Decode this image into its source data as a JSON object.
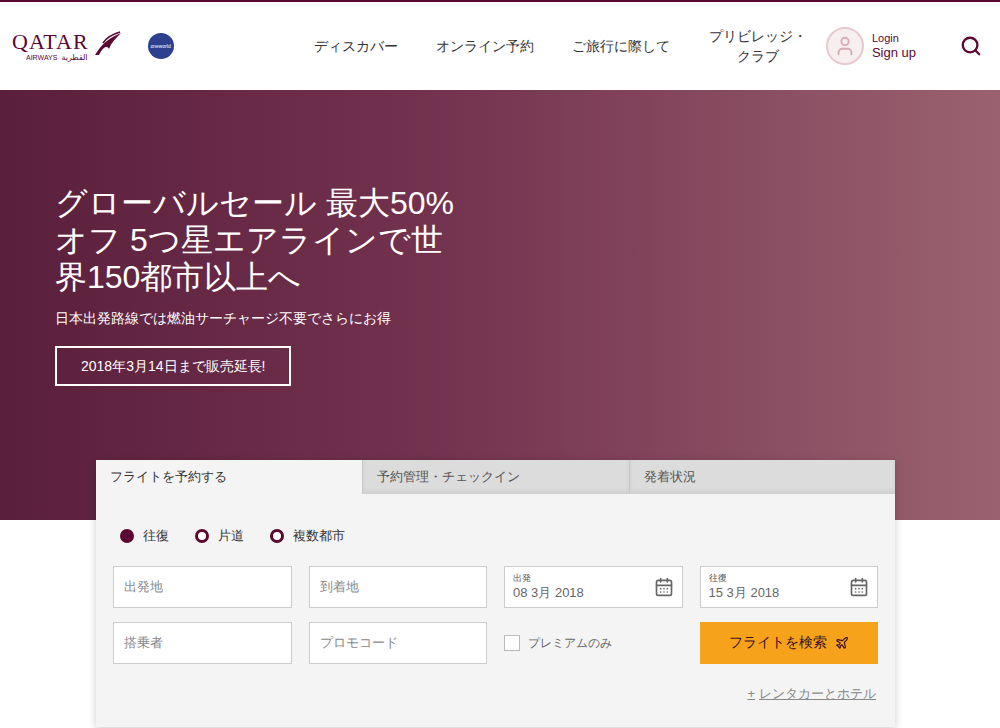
{
  "header": {
    "logo": {
      "name": "QATAR",
      "sub": "AIRWAYS",
      "arabic": "القطرية"
    },
    "alliance_badge": "oneworld",
    "nav": [
      "ディスカバー",
      "オンライン予約",
      "ご旅行に際して",
      "プリビレッジ・クラブ"
    ],
    "login": "Login",
    "signup": "Sign up"
  },
  "hero": {
    "headline_lines": [
      "グローバルセール 最大50%",
      "オフ 5つ星エアラインで世",
      "界150都市以上へ"
    ],
    "subline": "日本出発路線では燃油サーチャージ不要でさらにお得",
    "button": "2018年3月14日まで販売延長!"
  },
  "booking": {
    "tabs": [
      {
        "label": "フライトを予約する",
        "selected": true
      },
      {
        "label": "予約管理・チェックイン",
        "selected": false
      },
      {
        "label": "発着状況",
        "selected": false
      }
    ],
    "trip_types": [
      {
        "label": "往復",
        "selected": true
      },
      {
        "label": "片道",
        "selected": false
      },
      {
        "label": "複数都市",
        "selected": false
      }
    ],
    "fields": [
      {
        "kind": "text",
        "placeholder": "出発地"
      },
      {
        "kind": "text",
        "placeholder": "到着地"
      },
      {
        "kind": "date",
        "label": "出発",
        "value": "08 3月 2018"
      },
      {
        "kind": "date",
        "label": "往復",
        "value": "15 3月 2018"
      },
      {
        "kind": "text",
        "placeholder": "搭乗者"
      },
      {
        "kind": "text",
        "placeholder": "プロモコード"
      },
      {
        "kind": "checkbox",
        "label": "プレミアムのみ",
        "checked": false
      },
      {
        "kind": "button",
        "label": "フライトを検索"
      }
    ],
    "extra_link": {
      "icon": "+",
      "label": "レンタカーとホテル"
    }
  }
}
